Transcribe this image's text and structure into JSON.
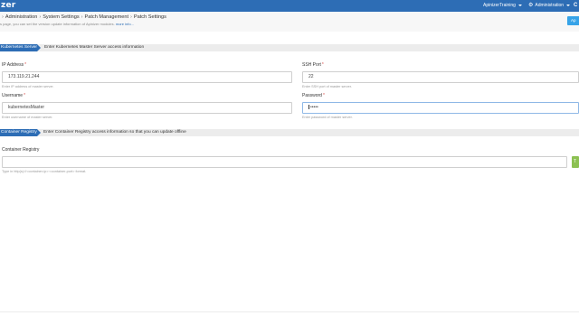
{
  "app": {
    "logo": "zer",
    "user_menu": "ApinizerTraining",
    "admin_menu": "Administration",
    "edge_glyph": "C"
  },
  "header": {
    "breadcrumb": [
      "Administration",
      "System Settings",
      "Patch Management",
      "Patch Settings"
    ],
    "subtitle": "s page, you can set the version update information of Apinizer modules.",
    "more_link": "more info...",
    "action_button": "Ap"
  },
  "kubernetes": {
    "tag": "Kubernetes Server",
    "description": "Enter Kubernetes Master Server access information",
    "ip_address": {
      "label": "IP Address",
      "value": "173.119.21.244",
      "help": "Enter IP address of master server."
    },
    "ssh_port": {
      "label": "SSH Port",
      "value": "22",
      "help": "Enter SSH port of master server."
    },
    "username": {
      "label": "Username",
      "value": "kubernetesMaster",
      "help": "Enter username of master server."
    },
    "password": {
      "label": "Password",
      "value": "•••••",
      "help": "Enter password of master server."
    }
  },
  "registry": {
    "tag": "Container Registry",
    "description": "Enter Container Registry access information so that you can update offline",
    "field": {
      "label": "Container Registry",
      "value": "",
      "help": "Type in http(s)://<container-ip>:<container-port> format."
    },
    "addon_button": "T"
  },
  "colors": {
    "topbar": "#2d6db5",
    "section_tag": "#2d6db5",
    "action_button": "#36a3e8",
    "addon_button": "#8cc152",
    "required": "#d9534f"
  },
  "icons": {
    "admin": "gear-icon",
    "menu_caret": "caret-down-icon"
  }
}
